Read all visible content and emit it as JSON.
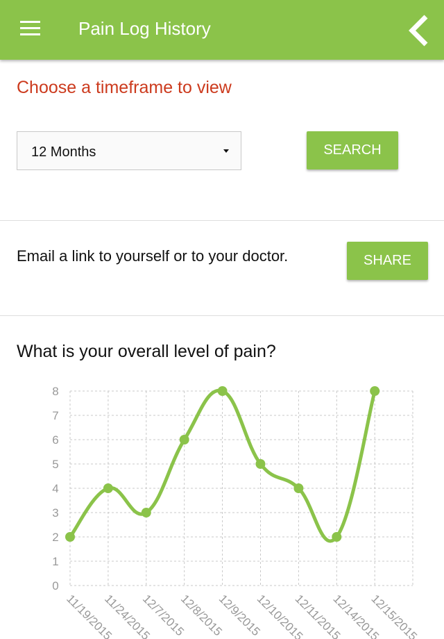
{
  "header": {
    "title": "Pain Log History",
    "menu_icon": "hamburger-menu-icon",
    "back_icon": "chevron-left-icon"
  },
  "timeframe": {
    "prompt": "Choose a timeframe to view",
    "selected": "12 Months",
    "search_label": "SEARCH"
  },
  "share": {
    "text": "Email a link to yourself or to your doctor.",
    "button_label": "SHARE"
  },
  "chart_section": {
    "question": "What is your overall level of pain?"
  },
  "colors": {
    "primary": "#8bc34a",
    "prompt": "#cc3a1d",
    "grid": "#c8c8c8",
    "ticks": "#999999"
  },
  "chart_data": {
    "type": "line",
    "categories": [
      "11/19/2015",
      "11/24/2015",
      "12/7/2015",
      "12/8/2015",
      "12/9/2015",
      "12/10/2015",
      "12/11/2015",
      "12/14/2015",
      "12/15/2015"
    ],
    "values": [
      2,
      4,
      3,
      6,
      8,
      5,
      4,
      2,
      8
    ],
    "ylim": [
      0,
      8
    ],
    "yticks": [
      "0",
      "1",
      "2",
      "3",
      "4",
      "5",
      "6",
      "7",
      "8"
    ],
    "grid": true,
    "smooth": true
  }
}
